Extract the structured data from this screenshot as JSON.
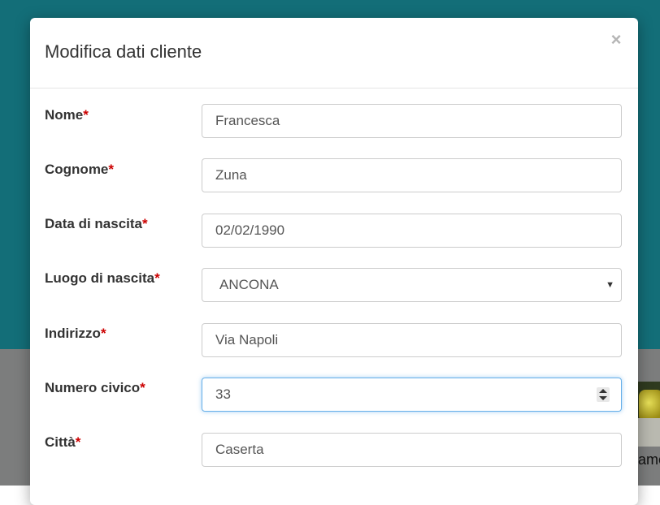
{
  "modal": {
    "title": "Modifica dati cliente",
    "close_icon": "×"
  },
  "form": {
    "required_marker": "*",
    "fields": [
      {
        "label": "Nome",
        "value": "Francesca",
        "type": "text"
      },
      {
        "label": "Cognome",
        "value": "Zuna",
        "type": "text"
      },
      {
        "label": "Data di nascita",
        "value": "02/02/1990",
        "type": "date"
      },
      {
        "label": "Luogo di nascita",
        "value": "ANCONA",
        "type": "select"
      },
      {
        "label": "Indirizzo",
        "value": "Via Napoli",
        "type": "text"
      },
      {
        "label": "Numero civico",
        "value": "33",
        "type": "number",
        "focused": true
      },
      {
        "label": "Città",
        "value": "Caserta",
        "type": "text"
      }
    ]
  },
  "background": {
    "partial_text": "ame"
  },
  "colors": {
    "backdrop_top": "#136e78",
    "backdrop_bottom": "#7c7d7d",
    "required": "#cc0000",
    "focus_border": "#66afe9"
  }
}
